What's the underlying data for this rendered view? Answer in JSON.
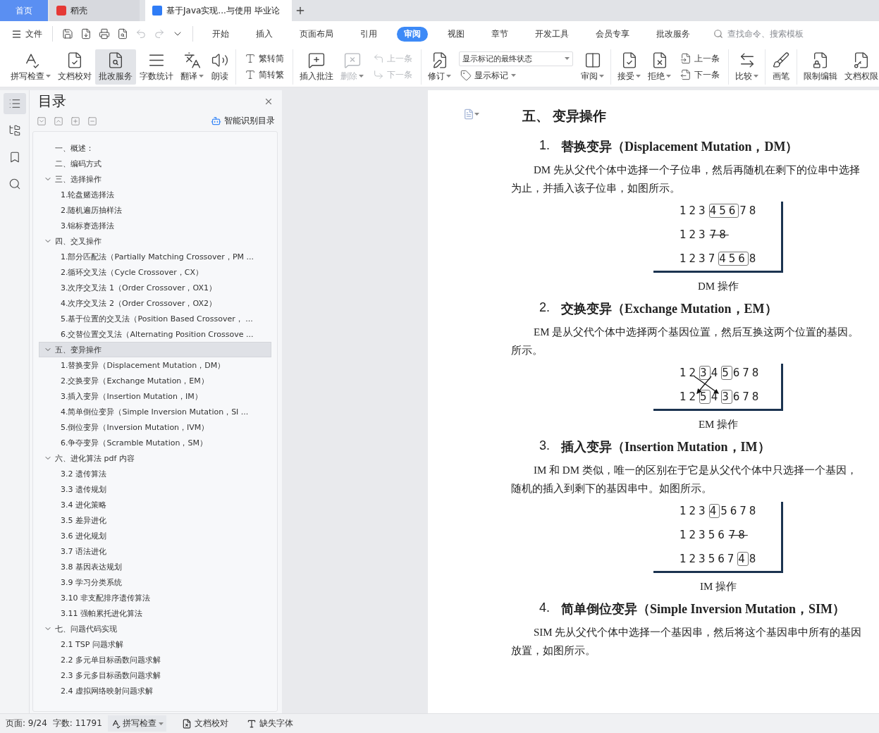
{
  "tabs": [
    {
      "label": "首页",
      "kind": "home",
      "selected": false
    },
    {
      "label": "稻壳",
      "kind": "app",
      "selected": false
    },
    {
      "label": "基于Java实现...与使用 毕业论",
      "kind": "doc",
      "selected": true
    }
  ],
  "menu": {
    "file": "文件",
    "quick_tools": [
      {
        "disabled": false
      },
      {
        "disabled": false
      },
      {
        "disabled": false
      },
      {
        "disabled": false
      },
      {
        "disabled": true
      },
      {
        "disabled": true
      },
      {
        "disabled": false
      }
    ],
    "tabs": [
      {
        "label": "开始",
        "selected": false
      },
      {
        "label": "插入",
        "selected": false
      },
      {
        "label": "页面布局",
        "selected": false
      },
      {
        "label": "引用",
        "selected": false
      },
      {
        "label": "审阅",
        "selected": true
      },
      {
        "label": "视图",
        "selected": false
      },
      {
        "label": "章节",
        "selected": false
      },
      {
        "label": "开发工具",
        "selected": false
      },
      {
        "label": "会员专享",
        "selected": false
      },
      {
        "label": "批改服务",
        "selected": false
      }
    ],
    "search": {
      "placeholder": "查找命令、搜索模板"
    }
  },
  "ribbon": [
    {
      "items": [
        {
          "kind": "large",
          "label": "拼写检查",
          "dropdown": true,
          "pressed": false,
          "disabled": false
        },
        {
          "kind": "large",
          "label": "文档校对",
          "dropdown": false,
          "pressed": false,
          "disabled": false
        },
        {
          "kind": "large",
          "label": "批改服务",
          "dropdown": false,
          "pressed": true,
          "disabled": false
        },
        {
          "kind": "large",
          "label": "字数统计",
          "dropdown": false,
          "pressed": false,
          "disabled": false
        },
        {
          "kind": "large",
          "label": "翻译",
          "dropdown": true,
          "pressed": false,
          "disabled": false
        },
        {
          "kind": "large",
          "label": "朗读",
          "dropdown": false,
          "pressed": false,
          "disabled": false
        }
      ]
    },
    {
      "items": [
        {
          "kind": "stack",
          "items": [
            {
              "kind": "small",
              "label": "繁转简",
              "dropdown": false,
              "disabled": false
            },
            {
              "kind": "small",
              "label": "简转繁",
              "dropdown": false,
              "disabled": false
            }
          ]
        }
      ]
    },
    {
      "items": [
        {
          "kind": "large",
          "label": "插入批注",
          "dropdown": false,
          "pressed": false,
          "disabled": false
        },
        {
          "kind": "large",
          "label": "删除",
          "dropdown": true,
          "pressed": false,
          "disabled": true
        },
        {
          "kind": "stack",
          "items": [
            {
              "kind": "small",
              "label": "上一条",
              "dropdown": false,
              "disabled": true
            },
            {
              "kind": "small",
              "label": "下一条",
              "dropdown": false,
              "disabled": true
            }
          ]
        }
      ]
    },
    {
      "items": [
        {
          "kind": "large",
          "label": "修订",
          "dropdown": true,
          "pressed": false,
          "disabled": false
        },
        {
          "kind": "stack",
          "items": [
            {
              "kind": "select",
              "value": "显示标记的最终状态"
            },
            {
              "kind": "small",
              "label": "显示标记",
              "dropdown": true,
              "disabled": false
            }
          ]
        },
        {
          "kind": "large",
          "label": "审阅",
          "dropdown": true,
          "pressed": false,
          "disabled": false
        }
      ]
    },
    {
      "items": [
        {
          "kind": "large",
          "label": "接受",
          "dropdown": true,
          "pressed": false,
          "disabled": false
        },
        {
          "kind": "large",
          "label": "拒绝",
          "dropdown": true,
          "pressed": false,
          "disabled": false
        },
        {
          "kind": "stack",
          "items": [
            {
              "kind": "small",
              "label": "上一条",
              "dropdown": false,
              "disabled": false
            },
            {
              "kind": "small",
              "label": "下一条",
              "dropdown": false,
              "disabled": false
            }
          ]
        }
      ]
    },
    {
      "items": [
        {
          "kind": "large",
          "label": "比较",
          "dropdown": true,
          "pressed": false,
          "disabled": false
        }
      ]
    },
    {
      "items": [
        {
          "kind": "large",
          "label": "画笔",
          "dropdown": false,
          "pressed": false,
          "disabled": false
        }
      ]
    },
    {
      "items": [
        {
          "kind": "large",
          "label": "限制编辑",
          "dropdown": false,
          "pressed": false,
          "disabled": false
        },
        {
          "kind": "large",
          "label": "文档权限",
          "dropdown": false,
          "pressed": false,
          "disabled": false
        }
      ]
    }
  ],
  "rail": [
    {
      "selected": true
    },
    {
      "selected": false
    },
    {
      "selected": false
    },
    {
      "selected": false
    }
  ],
  "toc": {
    "title": "目录",
    "smart": "智能识别目录",
    "items": [
      {
        "label": "一、概述：",
        "selected": false
      },
      {
        "label": "二、编码方式",
        "selected": false
      },
      {
        "label": "三、选择操作",
        "selected": false,
        "expanded": true,
        "children": [
          {
            "label": "1.轮盘赌选择法",
            "selected": false
          },
          {
            "label": "2.随机遍历抽样法",
            "selected": false
          },
          {
            "label": "3.锦标赛选择法",
            "selected": false
          }
        ]
      },
      {
        "label": "四、交叉操作",
        "selected": false,
        "expanded": true,
        "children": [
          {
            "label": "1.部分匹配法（Partially Matching Crossover，PM ...",
            "selected": false
          },
          {
            "label": "2.循环交叉法（Cycle Crossover，CX）",
            "selected": false
          },
          {
            "label": "3.次序交叉法 1（Order Crossover，OX1）",
            "selected": false
          },
          {
            "label": "4.次序交叉法 2（Order Crossover，OX2）",
            "selected": false
          },
          {
            "label": "5.基于位置的交叉法（Position Based Crossover， ...",
            "selected": false
          },
          {
            "label": "6.交替位置交叉法（Alternating Position Crossove ...",
            "selected": false
          }
        ]
      },
      {
        "label": "五、变异操作",
        "selected": true,
        "expanded": true,
        "children": [
          {
            "label": "1.替换变异（Displacement Mutation，DM）",
            "selected": false
          },
          {
            "label": "2.交换变异（Exchange Mutation，EM）",
            "selected": false
          },
          {
            "label": "3.插入变异（Insertion Mutation，IM）",
            "selected": false
          },
          {
            "label": "4.简单倒位变异（Simple Inversion Mutation，SI ...",
            "selected": false
          },
          {
            "label": "5.倒位变异（Inversion Mutation，IVM）",
            "selected": false
          },
          {
            "label": "6.争夺变异（Scramble Mutation，SM）",
            "selected": false
          }
        ]
      },
      {
        "label": "六、进化算法 pdf 内容",
        "selected": false,
        "expanded": true,
        "children": [
          {
            "label": "3.2  遗传算法",
            "selected": false
          },
          {
            "label": "3.3  遗传规划",
            "selected": false
          },
          {
            "label": "3.4  进化策略",
            "selected": false
          },
          {
            "label": "3.5  差异进化",
            "selected": false
          },
          {
            "label": "3.6  进化规划",
            "selected": false
          },
          {
            "label": "3.7  语法进化",
            "selected": false
          },
          {
            "label": "3.8  基因表达规划",
            "selected": false
          },
          {
            "label": "3.9  学习分类系统",
            "selected": false
          },
          {
            "label": "3.10  非支配排序遗传算法",
            "selected": false
          },
          {
            "label": "3.11  强帕累托进化算法",
            "selected": false
          }
        ]
      },
      {
        "label": "七、问题代码实现",
        "selected": false,
        "expanded": true,
        "children": [
          {
            "label": "2.1 TSP 问题求解",
            "selected": false
          },
          {
            "label": "2.2  多元单目标函数问题求解",
            "selected": false
          },
          {
            "label": "2.3  多元多目标函数问题求解",
            "selected": false
          },
          {
            "label": "2.4  虚拟网络映射问题求解",
            "selected": false
          }
        ]
      }
    ]
  },
  "doc": {
    "blocks": [
      {
        "kind": "h1",
        "text": "五、 变异操作"
      },
      {
        "kind": "h2",
        "number": "1.",
        "text": "替换变异（Displacement Mutation，DM）"
      },
      {
        "kind": "para",
        "lines": [
          "DM 先从父代个体中选择一个子位串，然后再随机在剩下的位串中选择",
          "为止，并插入该子位串，如图所示。"
        ]
      },
      {
        "kind": "figure",
        "arrows": false,
        "rows": [
          {
            "segments": [
              {
                "text": "123",
                "boxed": false,
                "struck": false
              },
              {
                "text": "456",
                "boxed": true,
                "struck": false
              },
              {
                "text": "78",
                "boxed": false,
                "struck": false
              }
            ]
          },
          {
            "segments": [
              {
                "text": "123",
                "boxed": false,
                "struck": false
              },
              {
                "text": "78",
                "boxed": false,
                "struck": true
              }
            ]
          },
          {
            "segments": [
              {
                "text": "1237",
                "boxed": false,
                "struck": false
              },
              {
                "text": "456",
                "boxed": true,
                "struck": false
              },
              {
                "text": "8",
                "boxed": false,
                "struck": false
              }
            ]
          }
        ]
      },
      {
        "kind": "caption",
        "text": "DM 操作"
      },
      {
        "kind": "h2",
        "number": "2.",
        "text": "交换变异（Exchange Mutation，EM）"
      },
      {
        "kind": "para",
        "lines": [
          "EM 是从父代个体中选择两个基因位置，然后互换这两个位置的基因。",
          "所示。"
        ]
      },
      {
        "kind": "figure",
        "arrows": true,
        "rows": [
          {
            "segments": [
              {
                "text": "12",
                "boxed": false,
                "struck": false
              },
              {
                "text": "3",
                "boxed": true,
                "struck": false
              },
              {
                "text": "4",
                "boxed": false,
                "struck": false
              },
              {
                "text": "5",
                "boxed": true,
                "struck": false
              },
              {
                "text": "678",
                "boxed": false,
                "struck": false
              }
            ]
          },
          {
            "segments": [
              {
                "text": "12",
                "boxed": false,
                "struck": false
              },
              {
                "text": "5",
                "boxed": true,
                "struck": false
              },
              {
                "text": "4",
                "boxed": false,
                "struck": false
              },
              {
                "text": "3",
                "boxed": true,
                "struck": false
              },
              {
                "text": "678",
                "boxed": false,
                "struck": false
              }
            ]
          }
        ]
      },
      {
        "kind": "caption",
        "text": "EM 操作"
      },
      {
        "kind": "h2",
        "number": "3.",
        "text": "插入变异（Insertion Mutation，IM）"
      },
      {
        "kind": "para",
        "lines": [
          "IM 和 DM 类似，唯一的区别在于它是从父代个体中只选择一个基因，",
          "随机的插入到剩下的基因串中。如图所示。"
        ]
      },
      {
        "kind": "figure",
        "arrows": false,
        "rows": [
          {
            "segments": [
              {
                "text": "123",
                "boxed": false,
                "struck": false
              },
              {
                "text": "4",
                "boxed": true,
                "struck": false
              },
              {
                "text": "5678",
                "boxed": false,
                "struck": false
              }
            ]
          },
          {
            "segments": [
              {
                "text": "12356",
                "boxed": false,
                "struck": false
              },
              {
                "text": "78",
                "boxed": false,
                "struck": true
              }
            ]
          },
          {
            "segments": [
              {
                "text": "123567",
                "boxed": false,
                "struck": false
              },
              {
                "text": "4",
                "boxed": true,
                "struck": false
              },
              {
                "text": "8",
                "boxed": false,
                "struck": false
              }
            ]
          }
        ]
      },
      {
        "kind": "caption",
        "text": "IM 操作"
      },
      {
        "kind": "h2",
        "number": "4.",
        "text": "简单倒位变异（Simple Inversion Mutation，SIM）"
      },
      {
        "kind": "para",
        "lines": [
          "SIM 先从父代个体中选择一个基因串，然后将这个基因串中所有的基因",
          "放置，如图所示。"
        ]
      }
    ]
  },
  "status": {
    "page": "页面: 9/24",
    "words": "字数: 11791",
    "spell": "拼写检查",
    "proof": "文档校对",
    "fonts": "缺失字体"
  }
}
